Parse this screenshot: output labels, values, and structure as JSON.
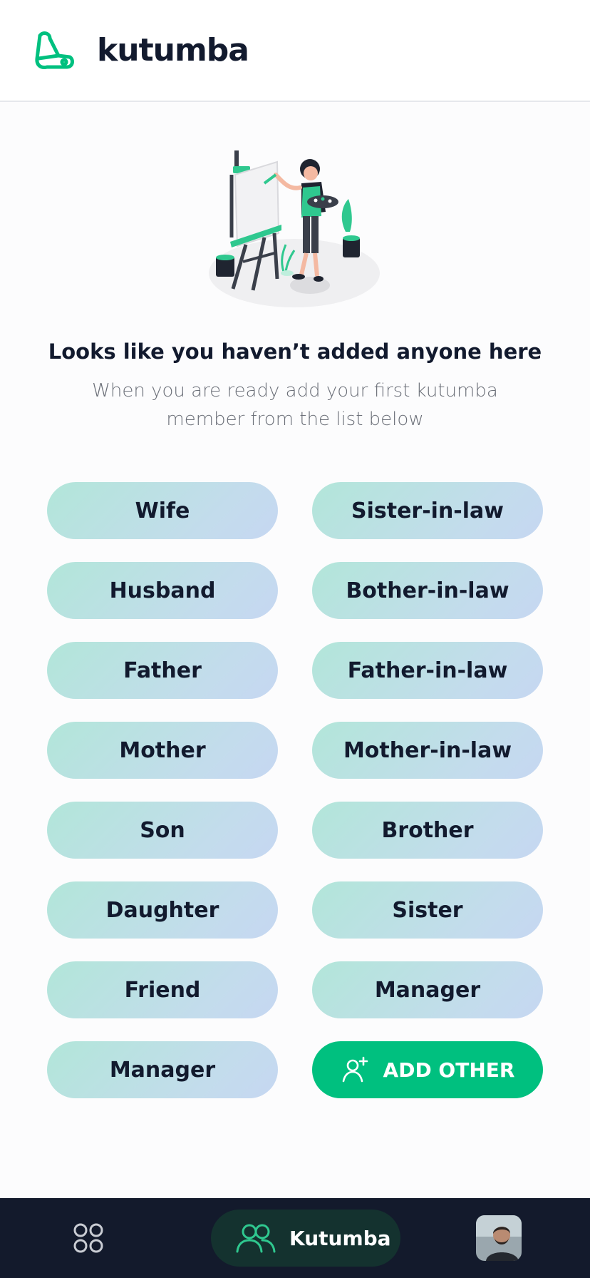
{
  "header": {
    "brand": "kutumba",
    "icon": "kutumba-logo-icon",
    "accent_color": "#00c07f"
  },
  "empty_state": {
    "illustration": "painter-illustration",
    "title": "Looks like you haven’t added anyone here",
    "subtitle": "When you are ready add your first kutumba member from the list below"
  },
  "relations": {
    "left": [
      "Wife",
      "Husband",
      "Father",
      "Mother",
      "Son",
      "Daughter",
      "Friend",
      "Manager"
    ],
    "right": [
      "Sister-in-law",
      "Bother-in-law",
      "Father-in-law",
      "Mother-in-law",
      "Brother",
      "Sister",
      "Manager"
    ],
    "add_other_label": "ADD OTHER",
    "add_other_icon": "add-user-icon"
  },
  "bottom_nav": {
    "menu_icon": "grid-icon",
    "active_label": "Kutumba",
    "active_icon": "people-icon",
    "profile": "avatar",
    "background": "#131a2c"
  }
}
